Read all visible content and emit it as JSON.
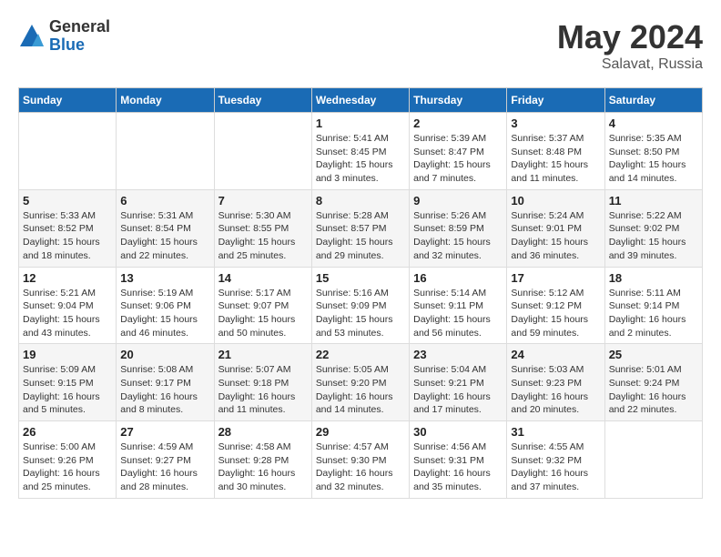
{
  "header": {
    "logo_general": "General",
    "logo_blue": "Blue",
    "month": "May 2024",
    "location": "Salavat, Russia"
  },
  "weekdays": [
    "Sunday",
    "Monday",
    "Tuesday",
    "Wednesday",
    "Thursday",
    "Friday",
    "Saturday"
  ],
  "weeks": [
    [
      {
        "day": "",
        "info": ""
      },
      {
        "day": "",
        "info": ""
      },
      {
        "day": "",
        "info": ""
      },
      {
        "day": "1",
        "info": "Sunrise: 5:41 AM\nSunset: 8:45 PM\nDaylight: 15 hours\nand 3 minutes."
      },
      {
        "day": "2",
        "info": "Sunrise: 5:39 AM\nSunset: 8:47 PM\nDaylight: 15 hours\nand 7 minutes."
      },
      {
        "day": "3",
        "info": "Sunrise: 5:37 AM\nSunset: 8:48 PM\nDaylight: 15 hours\nand 11 minutes."
      },
      {
        "day": "4",
        "info": "Sunrise: 5:35 AM\nSunset: 8:50 PM\nDaylight: 15 hours\nand 14 minutes."
      }
    ],
    [
      {
        "day": "5",
        "info": "Sunrise: 5:33 AM\nSunset: 8:52 PM\nDaylight: 15 hours\nand 18 minutes."
      },
      {
        "day": "6",
        "info": "Sunrise: 5:31 AM\nSunset: 8:54 PM\nDaylight: 15 hours\nand 22 minutes."
      },
      {
        "day": "7",
        "info": "Sunrise: 5:30 AM\nSunset: 8:55 PM\nDaylight: 15 hours\nand 25 minutes."
      },
      {
        "day": "8",
        "info": "Sunrise: 5:28 AM\nSunset: 8:57 PM\nDaylight: 15 hours\nand 29 minutes."
      },
      {
        "day": "9",
        "info": "Sunrise: 5:26 AM\nSunset: 8:59 PM\nDaylight: 15 hours\nand 32 minutes."
      },
      {
        "day": "10",
        "info": "Sunrise: 5:24 AM\nSunset: 9:01 PM\nDaylight: 15 hours\nand 36 minutes."
      },
      {
        "day": "11",
        "info": "Sunrise: 5:22 AM\nSunset: 9:02 PM\nDaylight: 15 hours\nand 39 minutes."
      }
    ],
    [
      {
        "day": "12",
        "info": "Sunrise: 5:21 AM\nSunset: 9:04 PM\nDaylight: 15 hours\nand 43 minutes."
      },
      {
        "day": "13",
        "info": "Sunrise: 5:19 AM\nSunset: 9:06 PM\nDaylight: 15 hours\nand 46 minutes."
      },
      {
        "day": "14",
        "info": "Sunrise: 5:17 AM\nSunset: 9:07 PM\nDaylight: 15 hours\nand 50 minutes."
      },
      {
        "day": "15",
        "info": "Sunrise: 5:16 AM\nSunset: 9:09 PM\nDaylight: 15 hours\nand 53 minutes."
      },
      {
        "day": "16",
        "info": "Sunrise: 5:14 AM\nSunset: 9:11 PM\nDaylight: 15 hours\nand 56 minutes."
      },
      {
        "day": "17",
        "info": "Sunrise: 5:12 AM\nSunset: 9:12 PM\nDaylight: 15 hours\nand 59 minutes."
      },
      {
        "day": "18",
        "info": "Sunrise: 5:11 AM\nSunset: 9:14 PM\nDaylight: 16 hours\nand 2 minutes."
      }
    ],
    [
      {
        "day": "19",
        "info": "Sunrise: 5:09 AM\nSunset: 9:15 PM\nDaylight: 16 hours\nand 5 minutes."
      },
      {
        "day": "20",
        "info": "Sunrise: 5:08 AM\nSunset: 9:17 PM\nDaylight: 16 hours\nand 8 minutes."
      },
      {
        "day": "21",
        "info": "Sunrise: 5:07 AM\nSunset: 9:18 PM\nDaylight: 16 hours\nand 11 minutes."
      },
      {
        "day": "22",
        "info": "Sunrise: 5:05 AM\nSunset: 9:20 PM\nDaylight: 16 hours\nand 14 minutes."
      },
      {
        "day": "23",
        "info": "Sunrise: 5:04 AM\nSunset: 9:21 PM\nDaylight: 16 hours\nand 17 minutes."
      },
      {
        "day": "24",
        "info": "Sunrise: 5:03 AM\nSunset: 9:23 PM\nDaylight: 16 hours\nand 20 minutes."
      },
      {
        "day": "25",
        "info": "Sunrise: 5:01 AM\nSunset: 9:24 PM\nDaylight: 16 hours\nand 22 minutes."
      }
    ],
    [
      {
        "day": "26",
        "info": "Sunrise: 5:00 AM\nSunset: 9:26 PM\nDaylight: 16 hours\nand 25 minutes."
      },
      {
        "day": "27",
        "info": "Sunrise: 4:59 AM\nSunset: 9:27 PM\nDaylight: 16 hours\nand 28 minutes."
      },
      {
        "day": "28",
        "info": "Sunrise: 4:58 AM\nSunset: 9:28 PM\nDaylight: 16 hours\nand 30 minutes."
      },
      {
        "day": "29",
        "info": "Sunrise: 4:57 AM\nSunset: 9:30 PM\nDaylight: 16 hours\nand 32 minutes."
      },
      {
        "day": "30",
        "info": "Sunrise: 4:56 AM\nSunset: 9:31 PM\nDaylight: 16 hours\nand 35 minutes."
      },
      {
        "day": "31",
        "info": "Sunrise: 4:55 AM\nSunset: 9:32 PM\nDaylight: 16 hours\nand 37 minutes."
      },
      {
        "day": "",
        "info": ""
      }
    ]
  ]
}
